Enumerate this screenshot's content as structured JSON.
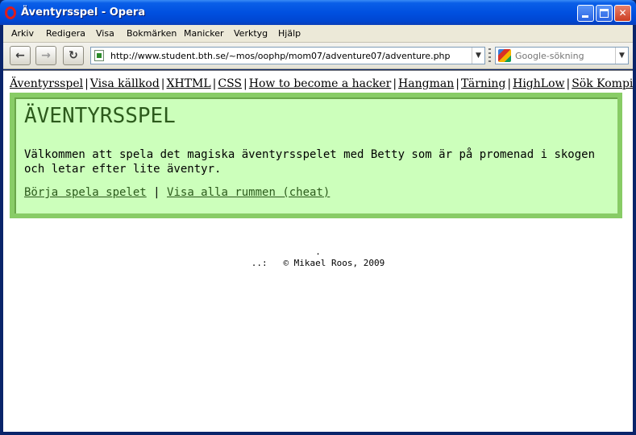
{
  "window": {
    "title": "Äventyrsspel - Opera"
  },
  "menubar": {
    "items": [
      "Arkiv",
      "Redigera",
      "Visa",
      "Bokmärken",
      "Manicker",
      "Verktyg",
      "Hjälp"
    ]
  },
  "toolbar": {
    "back_icon": "←",
    "forward_icon": "→",
    "reload_icon": "↻",
    "url": "http://www.student.bth.se/~mos/oophp/mom07/adventure07/adventure.php",
    "search_placeholder": "Google-sökning",
    "dropdown_icon": "▼"
  },
  "page": {
    "nav_links": [
      "Äventyrsspel",
      "Visa källkod",
      "XHTML",
      "CSS",
      "How to become a hacker",
      "Hangman",
      "Tärning",
      "HighLow",
      "Sök Kompis"
    ],
    "nav_separator": "|",
    "title": "ÄVENTYRSSPEL",
    "intro": "Välkommen att spela det magiska äventyrsspelet med Betty som är på promenad i skogen och letar efter lite äventyr.",
    "start_link": "Börja spela spelet",
    "link_separator": "|",
    "cheat_link": "Visa alla rummen (cheat)",
    "footer_dot": ".",
    "footer_text": "..:   © Mikael Roos, 2009"
  },
  "colors": {
    "panel_bg": "#ccffbb",
    "panel_border": "#88cc66",
    "title_color": "#2c5a1c",
    "titlebar_blue": "#0050e0"
  }
}
